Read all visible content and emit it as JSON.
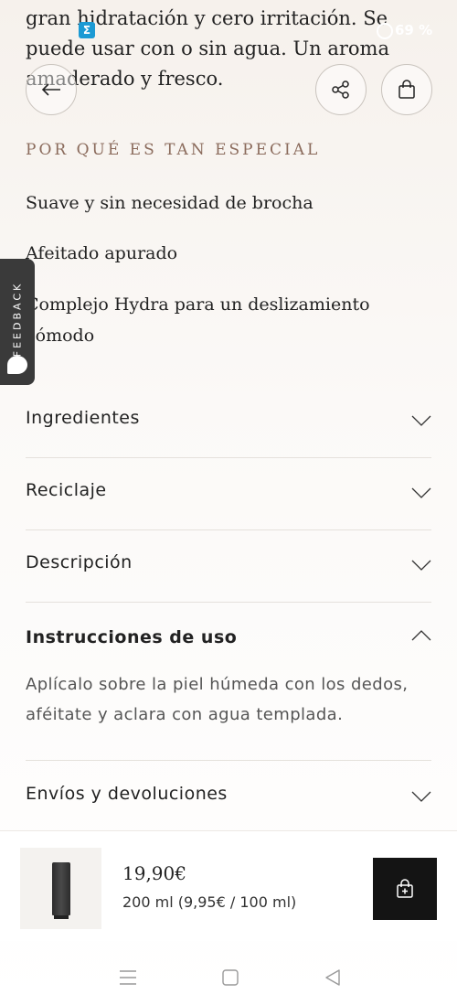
{
  "intro_text": {
    "line1": "gran hidratación y cero irritación. Se",
    "line2": "puede usar con o sin agua. Un aroma",
    "line3": "amaderado y fresco."
  },
  "status_bar": {
    "battery": "69 %"
  },
  "special": {
    "heading": "POR QUÉ ES TAN ESPECIAL",
    "features": [
      "Suave y sin necesidad de brocha",
      "Afeitado apurado",
      "Complejo Hydra para un deslizamiento cómodo"
    ]
  },
  "feedback": {
    "label": "FEEDBACK"
  },
  "accordion": [
    {
      "label": "Ingredientes",
      "expanded": false
    },
    {
      "label": "Reciclaje",
      "expanded": false
    },
    {
      "label": "Descripción",
      "expanded": false
    },
    {
      "label": "Instrucciones de uso",
      "expanded": true,
      "body": "Aplícalo sobre la piel húmeda con los dedos, aféitate y aclara con agua templada."
    },
    {
      "label": "Envíos y devoluciones",
      "expanded": false
    }
  ],
  "product_bar": {
    "price": "19,90€",
    "size": "200 ml (9,95€ / 100 ml)"
  },
  "icons": {
    "back": "arrow-left-icon",
    "share": "share-icon",
    "bag": "shopping-bag-icon",
    "add_to_bag": "bag-plus-icon"
  }
}
